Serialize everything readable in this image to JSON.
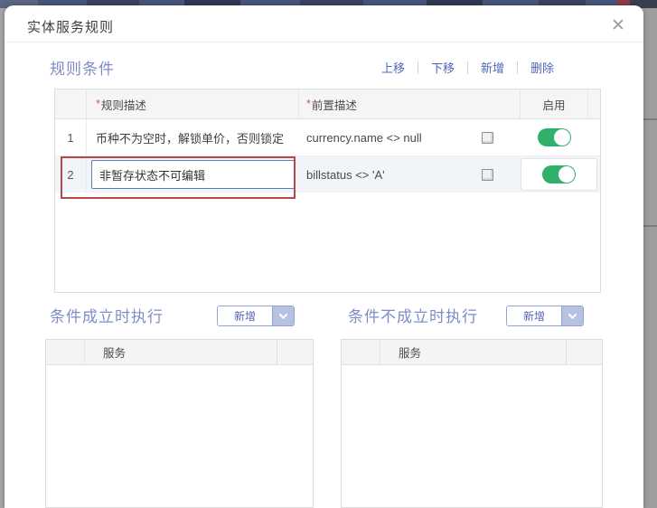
{
  "chrome": {
    "close_icon": "✕"
  },
  "dialog": {
    "title": "实体服务规则",
    "rule_section": {
      "heading": "规则条件",
      "required_mark": "*",
      "actions": {
        "move_up": "上移",
        "move_down": "下移",
        "add": "新增",
        "delete": "删除"
      },
      "columns": {
        "rule_desc": "规则描述",
        "precondition": "前置描述",
        "enabled": "启用"
      },
      "rows": [
        {
          "index": "1",
          "rule_desc": "币种不为空时，解锁单价，否则锁定",
          "precondition": "currency.name <> null",
          "enabled": true,
          "editing": false
        },
        {
          "index": "2",
          "rule_desc": "非暂存状态不可编辑",
          "precondition": "billstatus <> 'A'",
          "enabled": true,
          "editing": true
        }
      ],
      "annotation": "red highlight box around editing row"
    },
    "true_branch": {
      "heading": "条件成立时执行",
      "add_button": "新增",
      "service_column": "服务"
    },
    "false_branch": {
      "heading": "条件不成立时执行",
      "add_button": "新增",
      "service_column": "服务"
    }
  },
  "colors": {
    "accent_blue": "#5265bb",
    "heading_blue": "#7e8cc9",
    "toggle_on_green": "#2fb16b",
    "annotation_red": "#b8474a",
    "input_focus_border": "#5b7ab8"
  }
}
